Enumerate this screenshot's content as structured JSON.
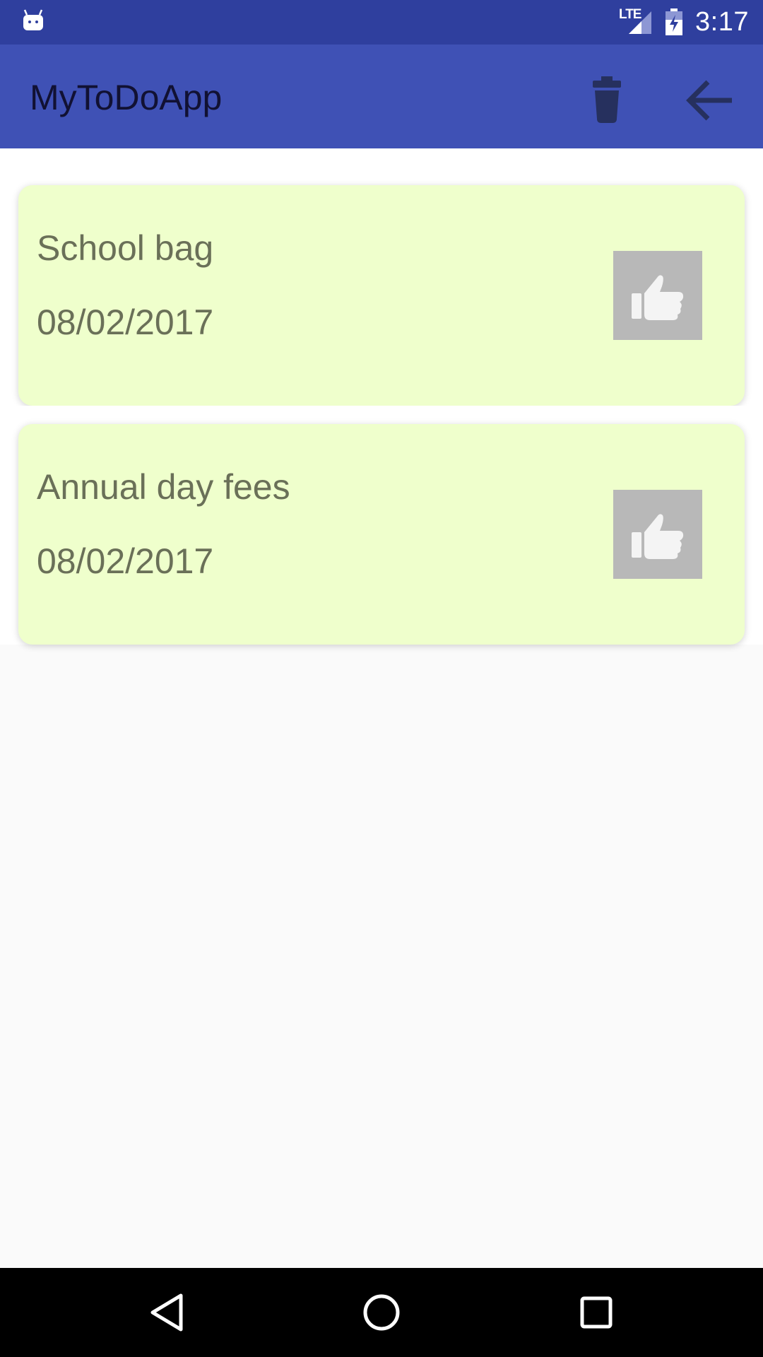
{
  "status_bar": {
    "network": "LTE",
    "time": "3:17",
    "icons": [
      "android-notification-icon",
      "signal-icon",
      "battery-charging-icon"
    ]
  },
  "app_bar": {
    "title": "MyToDoApp",
    "actions": [
      "trash-icon",
      "back-arrow-icon"
    ]
  },
  "tasks": [
    {
      "name": "School bag",
      "date": "08/02/2017",
      "icon": "thumbs-up-icon"
    },
    {
      "name": "Annual day fees",
      "date": "08/02/2017",
      "icon": "thumbs-up-icon"
    }
  ],
  "nav_bar": {
    "buttons": [
      "back-triangle-icon",
      "home-circle-icon",
      "recents-square-icon"
    ]
  },
  "colors": {
    "status_bar": "#2f3f9e",
    "app_bar": "#3f51b5",
    "card": "#efffcc",
    "card_text": "#6a7058",
    "like_button": "#b8b8b8",
    "background": "#fafafa"
  }
}
